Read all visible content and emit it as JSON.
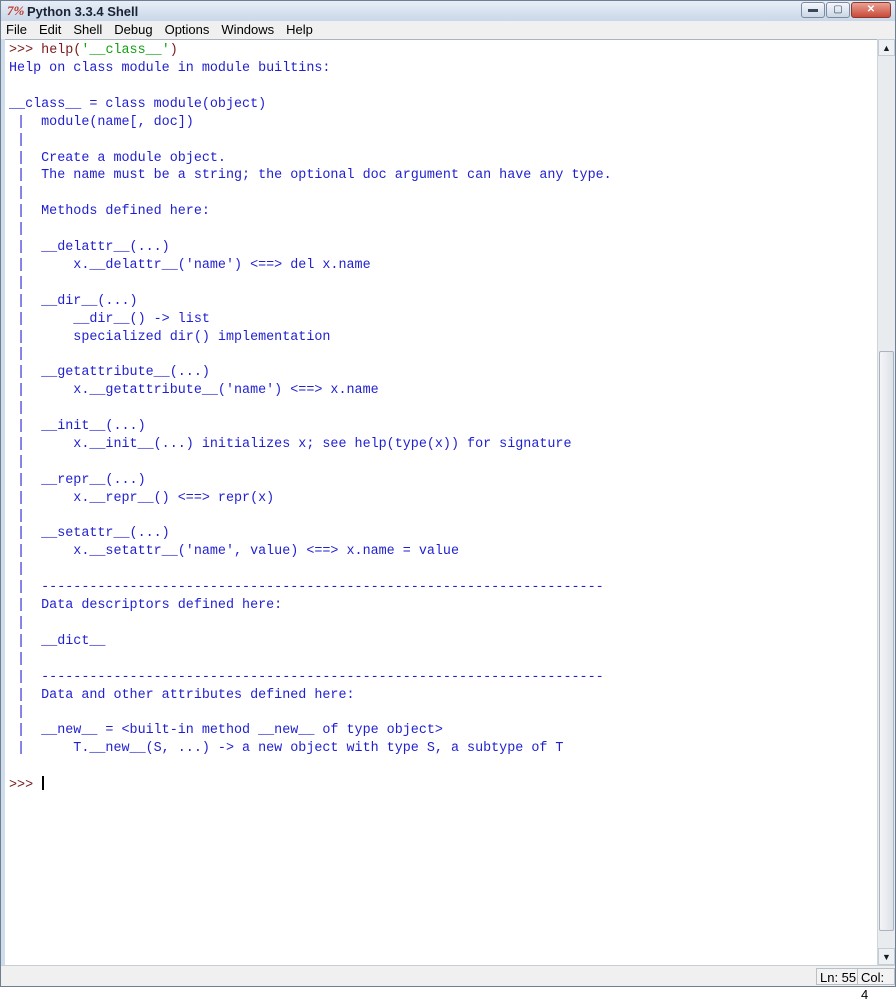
{
  "window": {
    "app_icon": "7%",
    "title": "Python 3.3.4 Shell",
    "controls": {
      "minimize": "▬",
      "maximize": "▢",
      "close": "✕"
    }
  },
  "menu": [
    "File",
    "Edit",
    "Shell",
    "Debug",
    "Options",
    "Windows",
    "Help"
  ],
  "shell": {
    "input": {
      "prompt": ">>> ",
      "code_before": "help(",
      "string": "'__class__'",
      "code_after": ")"
    },
    "output": [
      "Help on class module in module builtins:",
      "",
      "__class__ = class module(object)",
      " |  module(name[, doc])",
      " |  ",
      " |  Create a module object.",
      " |  The name must be a string; the optional doc argument can have any type.",
      " |  ",
      " |  Methods defined here:",
      " |  ",
      " |  __delattr__(...)",
      " |      x.__delattr__('name') <==> del x.name",
      " |  ",
      " |  __dir__(...)",
      " |      __dir__() -> list",
      " |      specialized dir() implementation",
      " |  ",
      " |  __getattribute__(...)",
      " |      x.__getattribute__('name') <==> x.name",
      " |  ",
      " |  __init__(...)",
      " |      x.__init__(...) initializes x; see help(type(x)) for signature",
      " |  ",
      " |  __repr__(...)",
      " |      x.__repr__() <==> repr(x)",
      " |  ",
      " |  __setattr__(...)",
      " |      x.__setattr__('name', value) <==> x.name = value",
      " |  ",
      " |  ----------------------------------------------------------------------",
      " |  Data descriptors defined here:",
      " |  ",
      " |  __dict__",
      " |  ",
      " |  ----------------------------------------------------------------------",
      " |  Data and other attributes defined here:",
      " |  ",
      " |  __new__ = <built-in method __new__ of type object>",
      " |      T.__new__(S, ...) -> a new object with type S, a subtype of T",
      ""
    ],
    "final_prompt": ">>> "
  },
  "scrollbar": {
    "up_arrow": "▲",
    "down_arrow": "▼"
  },
  "status": {
    "line": "Ln: 55",
    "col": "Col: 4"
  },
  "colors": {
    "output": "#1f1fd0",
    "prompt": "#7a1a1a",
    "string": "#12a012"
  }
}
